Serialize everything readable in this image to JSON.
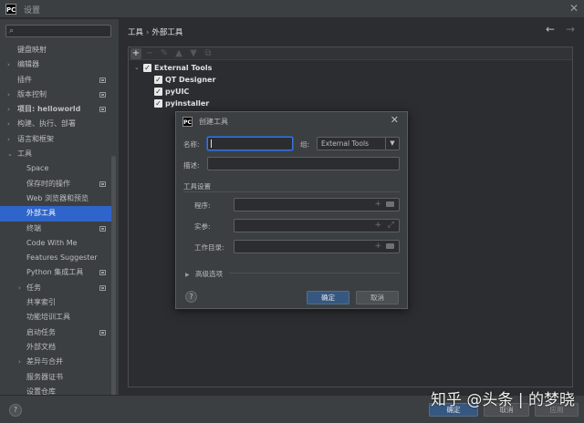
{
  "window": {
    "logo": "PC",
    "title": "设置"
  },
  "sidebar": {
    "items": [
      {
        "label": "键盘映射",
        "arrow": "",
        "mark": false,
        "child": false,
        "bold": false
      },
      {
        "label": "编辑器",
        "arrow": "›",
        "mark": false,
        "child": false,
        "bold": false
      },
      {
        "label": "插件",
        "arrow": "",
        "mark": true,
        "child": false,
        "bold": false
      },
      {
        "label": "版本控制",
        "arrow": "›",
        "mark": true,
        "child": false,
        "bold": false
      },
      {
        "label": "项目: helloworld",
        "arrow": "›",
        "mark": true,
        "child": false,
        "bold": true
      },
      {
        "label": "构建、执行、部署",
        "arrow": "›",
        "mark": false,
        "child": false,
        "bold": false
      },
      {
        "label": "语言和框架",
        "arrow": "›",
        "mark": false,
        "child": false,
        "bold": false
      },
      {
        "label": "工具",
        "arrow": "⌄",
        "mark": false,
        "child": false,
        "bold": false
      },
      {
        "label": "Space",
        "arrow": "",
        "mark": false,
        "child": true,
        "bold": false
      },
      {
        "label": "保存时的操作",
        "arrow": "",
        "mark": true,
        "child": true,
        "bold": false
      },
      {
        "label": "Web 浏览器和预览",
        "arrow": "",
        "mark": false,
        "child": true,
        "bold": false
      },
      {
        "label": "外部工具",
        "arrow": "",
        "mark": false,
        "child": true,
        "bold": false,
        "selected": true
      },
      {
        "label": "终端",
        "arrow": "",
        "mark": true,
        "child": true,
        "bold": false
      },
      {
        "label": "Code With Me",
        "arrow": "",
        "mark": false,
        "child": true,
        "bold": false
      },
      {
        "label": "Features Suggester",
        "arrow": "",
        "mark": false,
        "child": true,
        "bold": false
      },
      {
        "label": "Python 集成工具",
        "arrow": "",
        "mark": true,
        "child": true,
        "bold": false
      },
      {
        "label": "任务",
        "arrow": "›",
        "mark": true,
        "child": true,
        "bold": false
      },
      {
        "label": "共享索引",
        "arrow": "",
        "mark": false,
        "child": true,
        "bold": false
      },
      {
        "label": "功能培训工具",
        "arrow": "",
        "mark": false,
        "child": true,
        "bold": false
      },
      {
        "label": "启动任务",
        "arrow": "",
        "mark": true,
        "child": true,
        "bold": false
      },
      {
        "label": "外部文档",
        "arrow": "",
        "mark": false,
        "child": true,
        "bold": false
      },
      {
        "label": "差异与合并",
        "arrow": "›",
        "mark": false,
        "child": true,
        "bold": false
      },
      {
        "label": "服务器证书",
        "arrow": "",
        "mark": false,
        "child": true,
        "bold": false
      },
      {
        "label": "设置仓库",
        "arrow": "",
        "mark": false,
        "child": true,
        "bold": false
      }
    ]
  },
  "breadcrumb": {
    "root": "工具",
    "sep": "›",
    "current": "外部工具"
  },
  "nav": {
    "back": "←",
    "forward": "→"
  },
  "toolbar": {
    "add": "+",
    "remove": "−",
    "edit": "✎",
    "up": "▲",
    "down": "▼",
    "copy": "⧉"
  },
  "tools": {
    "group": "External Tools",
    "items": [
      "QT Designer",
      "pyUIC",
      "pyinstaller"
    ]
  },
  "dialog": {
    "logo": "PC",
    "title": "创建工具",
    "name_label": "名称:",
    "name_value": "",
    "group_label": "组:",
    "group_value": "External Tools",
    "description_label": "描述:",
    "description_value": "",
    "section_tool_settings": "工具设置",
    "program_label": "程序:",
    "arguments_label": "实参:",
    "workdir_label": "工作目录:",
    "advanced_label": "高级选项",
    "ok": "确定",
    "cancel": "取消"
  },
  "footer": {
    "ok": "确定",
    "cancel": "取消",
    "apply": "应用"
  },
  "watermark": "知乎 @头条 | 的梦晓"
}
